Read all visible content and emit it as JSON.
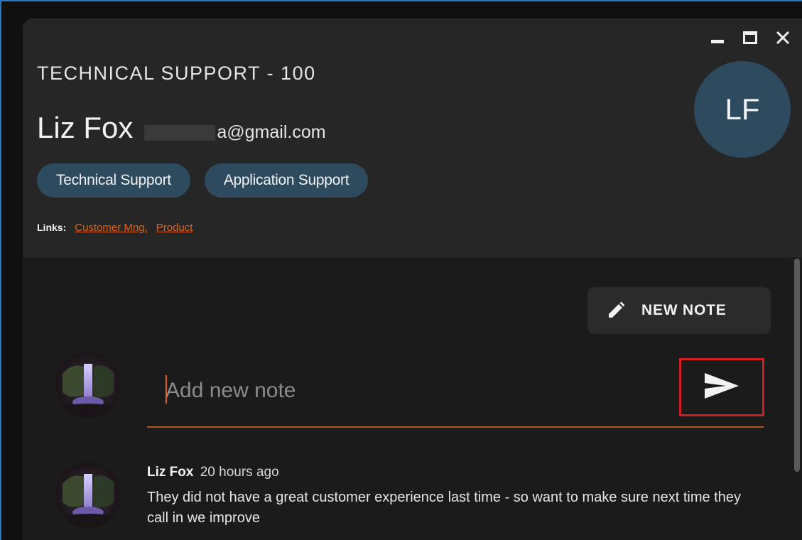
{
  "window": {
    "controls": {
      "minimize": "minimize-icon",
      "maximize": "maximize-icon",
      "close": "close-icon"
    }
  },
  "header": {
    "queue_title": "TECHNICAL SUPPORT - 100",
    "contact_name": "Liz Fox",
    "contact_email": "a@gmail.com",
    "avatar_initials": "LF",
    "tags": [
      "Technical Support",
      "Application Support"
    ],
    "links_label": "Links:",
    "links": [
      "Customer Mng.",
      "Product"
    ]
  },
  "notes": {
    "new_note_label": "NEW NOTE",
    "new_note_icon": "pencil-icon",
    "input_placeholder": "Add new note",
    "send_icon": "send-icon",
    "items": [
      {
        "author": "Liz Fox",
        "time": "20 hours ago",
        "body": "They did not have a great customer experience last time - so want to make sure next time they call in we improve"
      }
    ]
  },
  "colors": {
    "accent": "#e0621c",
    "chip": "#2d4a5e",
    "highlight_box": "#d11e22",
    "window_border": "#2b79c2"
  }
}
